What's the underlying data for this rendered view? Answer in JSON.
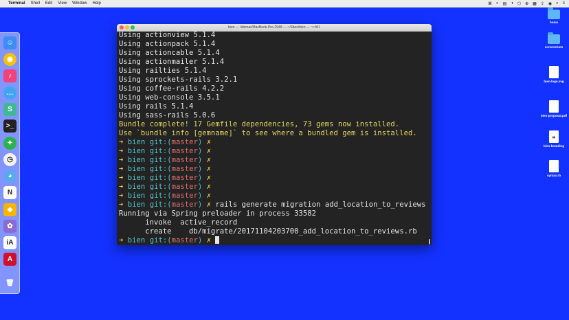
{
  "menubar": {
    "apple": "",
    "items": [
      "Terminal",
      "Shell",
      "Edit",
      "View",
      "Window",
      "Help"
    ],
    "status": [
      "⌘",
      "◐",
      "▤",
      "◑",
      "⬡",
      "⊕",
      "▦",
      "⇪",
      "◉",
      "⌕",
      "≡"
    ]
  },
  "terminal": {
    "title": "bien — /idomar/MacBook-Pro-2948 — ~/Sites/bien — ⌥⌘1",
    "lines": [
      {
        "kind": "plain",
        "text": "Using actionview 5.1.4"
      },
      {
        "kind": "plain",
        "text": "Using actionpack 5.1.4"
      },
      {
        "kind": "plain",
        "text": "Using actioncable 5.1.4"
      },
      {
        "kind": "plain",
        "text": "Using actionmailer 5.1.4"
      },
      {
        "kind": "plain",
        "text": "Using railties 5.1.4"
      },
      {
        "kind": "plain",
        "text": "Using sprockets-rails 3.2.1"
      },
      {
        "kind": "plain",
        "text": "Using coffee-rails 4.2.2"
      },
      {
        "kind": "plain",
        "text": "Using web-console 3.5.1"
      },
      {
        "kind": "plain",
        "text": "Using rails 5.1.4"
      },
      {
        "kind": "plain",
        "text": "Using sass-rails 5.0.6"
      },
      {
        "kind": "yellow",
        "text": "Bundle complete! 17 Gemfile dependencies, 73 gems now installed."
      },
      {
        "kind": "yellow",
        "text": "Use `bundle info [gemname]` to see where a bundled gem is installed."
      },
      {
        "kind": "prompt",
        "cmd": ""
      },
      {
        "kind": "prompt",
        "cmd": ""
      },
      {
        "kind": "prompt",
        "cmd": ""
      },
      {
        "kind": "prompt",
        "cmd": ""
      },
      {
        "kind": "prompt",
        "cmd": ""
      },
      {
        "kind": "prompt",
        "cmd": ""
      },
      {
        "kind": "prompt",
        "cmd": ""
      },
      {
        "kind": "prompt",
        "cmd": " rails generate migration add_location_to_reviews"
      },
      {
        "kind": "plain",
        "text": "Running via Spring preloader in process 33582"
      },
      {
        "kind": "plain",
        "text": "      invoke  active_record"
      },
      {
        "kind": "plain",
        "text": "      create    db/migrate/20171104203700_add_location_to_reviews.rb"
      },
      {
        "kind": "prompt",
        "cmd": " ",
        "cursor": true
      }
    ],
    "prompt": {
      "arrow": "➜",
      "name": "bien",
      "git": "git:(",
      "branch": "master",
      "close": ")",
      "x": "✗"
    }
  },
  "dock": [
    {
      "name": "finder-icon",
      "glyph": "☺",
      "bg": "#3d8df5"
    },
    {
      "name": "chrome-icon",
      "glyph": "◉",
      "bg": "#f4c20d"
    },
    {
      "name": "itunes-icon",
      "glyph": "♪",
      "bg": "#f0437d"
    },
    {
      "name": "messages-icon",
      "glyph": "…",
      "bg": "#41a6f0"
    },
    {
      "name": "slack-icon",
      "glyph": "S",
      "bg": "#3eb991"
    },
    {
      "name": "terminal-icon",
      "glyph": ">_",
      "bg": "#222222"
    },
    {
      "name": "safari-icon",
      "glyph": "✦",
      "bg": "#2ab24d"
    },
    {
      "name": "clock-icon",
      "glyph": "◷",
      "bg": "#f5f5f5"
    },
    {
      "name": "tweetbot-icon",
      "glyph": "◕",
      "bg": "#5aa9f0"
    },
    {
      "name": "notion-icon",
      "glyph": "N",
      "bg": "#ffffff"
    },
    {
      "name": "sketch-icon",
      "glyph": "◆",
      "bg": "#f7b500"
    },
    {
      "name": "palette-icon",
      "glyph": "✿",
      "bg": "#8a6bd1"
    },
    {
      "name": "ia-writer-icon",
      "glyph": "iA",
      "bg": "#ffffff"
    },
    {
      "name": "acrobat-icon",
      "glyph": "A",
      "bg": "#d0112b"
    },
    {
      "name": "trash-icon",
      "glyph": "🗑",
      "bg": "transparent"
    }
  ],
  "desktop": [
    {
      "type": "folder",
      "label": "home"
    },
    {
      "type": "folder",
      "label": "screenshots"
    },
    {
      "type": "doc",
      "label": "bien-logo.svg",
      "mark": ""
    },
    {
      "type": "doc",
      "label": "bien-proposal.pdf",
      "mark": ""
    },
    {
      "type": "doc",
      "label": "bien-branding",
      "mark": "▮▮"
    },
    {
      "type": "doc",
      "label": "syntax.rb",
      "mark": ""
    }
  ]
}
